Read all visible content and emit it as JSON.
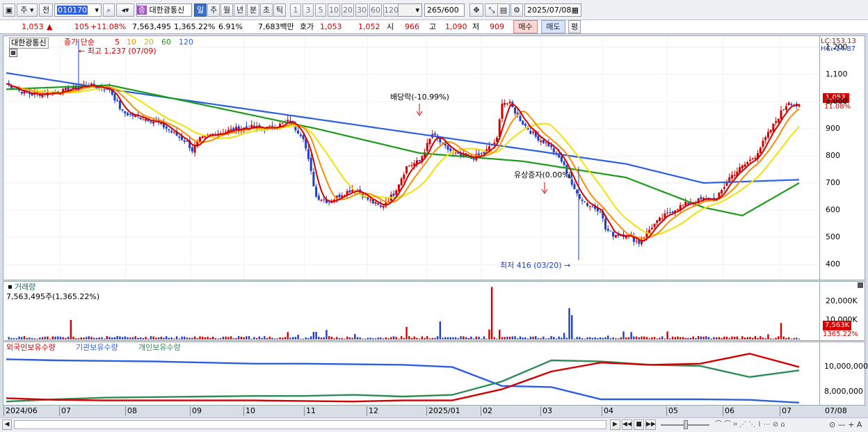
{
  "toolbar": {
    "period_label": "주",
    "prev_label": "전",
    "code": "010170",
    "stock_name": "대한광통신",
    "badge": "증",
    "periods": [
      "일",
      "주",
      "월",
      "년",
      "분",
      "초",
      "틱"
    ],
    "active_period": "일",
    "numbers": [
      "1",
      "3",
      "5",
      "10",
      "20",
      "30",
      "60",
      "120"
    ],
    "count": "265",
    "count_total": "/600",
    "date": "2025/07/08"
  },
  "quote": {
    "price": "1,053",
    "change": "105",
    "change_pct": "+11.08%",
    "volume": "7,563,495",
    "vol_ratio": "1,365.22%",
    "turnover": "6.91%",
    "amount": "7,683백만",
    "ask_label": "호가",
    "ask": "1,053",
    "bid": "1,052",
    "open_label": "시",
    "open": "966",
    "high_label": "고",
    "high": "1,090",
    "low_label": "저",
    "low": "909",
    "buy": "매수",
    "sell": "매도",
    "eval": "평"
  },
  "price_panel": {
    "name": "대한광통신",
    "legend_prefix": "종가 단순",
    "ma": [
      "5",
      "10",
      "20",
      "60",
      "120"
    ],
    "ma_colors": [
      "#d40000",
      "#ff8c00",
      "#f2e200",
      "#1a9b1a",
      "#2d5fe0"
    ],
    "high_note": "최고 1,237 (07/09)",
    "low_note": "최저 416 (03/20)",
    "div_note": "배당락(-10.99%)",
    "rights_note": "유상증자(0.00%)",
    "lc": "LC:153.13",
    "hc": "HC:-14.87",
    "last_price": "1,053",
    "last_pct": "11.08%",
    "yticks": [
      "1,200",
      "1,100",
      "1,000",
      "900",
      "800",
      "700",
      "600",
      "500",
      "400"
    ]
  },
  "volume_panel": {
    "title": "거래량",
    "info": "7,563,495주(1,365.22%)",
    "yticks": [
      "20,000K",
      "10,000K"
    ],
    "last": "7,563K",
    "last_pct": "1365.22%"
  },
  "holdings_panel": {
    "legend": [
      "외국인보유수량",
      "기관보유수량",
      "개인보유수량"
    ],
    "colors": [
      "#d40000",
      "#2d5fe0",
      "#2e8b57"
    ],
    "yticks": [
      "10,000,000",
      "8,000,000"
    ]
  },
  "xaxis": [
    "2024/06",
    "07",
    "08",
    "09",
    "10",
    "11",
    "12",
    "2025/01",
    "02",
    "03",
    "04",
    "05",
    "06",
    "07"
  ],
  "xaxis_right": "07/08",
  "chart_data": {
    "type": "candlestick",
    "ylim": [
      380,
      1230
    ],
    "close_path": [
      [
        0,
        1065
      ],
      [
        5,
        1040
      ],
      [
        10,
        1025
      ],
      [
        15,
        1030
      ],
      [
        20,
        1035
      ],
      [
        25,
        1045
      ],
      [
        30,
        1060
      ],
      [
        35,
        1055
      ],
      [
        40,
        1045
      ],
      [
        45,
        960
      ],
      [
        50,
        945
      ],
      [
        55,
        935
      ],
      [
        60,
        915
      ],
      [
        65,
        880
      ],
      [
        70,
        850
      ],
      [
        72,
        820
      ],
      [
        75,
        860
      ],
      [
        80,
        880
      ],
      [
        85,
        890
      ],
      [
        90,
        900
      ],
      [
        95,
        905
      ],
      [
        100,
        900
      ],
      [
        105,
        910
      ],
      [
        110,
        930
      ],
      [
        112,
        900
      ],
      [
        115,
        870
      ],
      [
        120,
        650
      ],
      [
        125,
        630
      ],
      [
        130,
        660
      ],
      [
        135,
        680
      ],
      [
        140,
        640
      ],
      [
        145,
        610
      ],
      [
        150,
        660
      ],
      [
        155,
        760
      ],
      [
        160,
        780
      ],
      [
        165,
        880
      ],
      [
        170,
        830
      ],
      [
        175,
        800
      ],
      [
        180,
        790
      ],
      [
        185,
        810
      ],
      [
        190,
        860
      ],
      [
        192,
        1000
      ],
      [
        195,
        990
      ],
      [
        200,
        920
      ],
      [
        205,
        870
      ],
      [
        210,
        840
      ],
      [
        215,
        780
      ],
      [
        218,
        720
      ],
      [
        220,
        670
      ],
      [
        225,
        620
      ],
      [
        230,
        600
      ],
      [
        232,
        530
      ],
      [
        235,
        510
      ],
      [
        240,
        510
      ],
      [
        245,
        480
      ],
      [
        250,
        540
      ],
      [
        255,
        580
      ],
      [
        260,
        610
      ],
      [
        265,
        630
      ],
      [
        270,
        640
      ],
      [
        275,
        640
      ],
      [
        280,
        720
      ],
      [
        285,
        760
      ],
      [
        290,
        800
      ],
      [
        295,
        880
      ],
      [
        300,
        960
      ],
      [
        303,
        1000
      ],
      [
        307,
        980
      ]
    ],
    "ma_120": [
      [
        0,
        1105
      ],
      [
        40,
        1045
      ],
      [
        80,
        990
      ],
      [
        120,
        935
      ],
      [
        160,
        880
      ],
      [
        200,
        825
      ],
      [
        240,
        770
      ],
      [
        270,
        700
      ],
      [
        307,
        712
      ]
    ],
    "ma_60": [
      [
        0,
        1045
      ],
      [
        40,
        1060
      ],
      [
        80,
        980
      ],
      [
        120,
        900
      ],
      [
        160,
        810
      ],
      [
        200,
        780
      ],
      [
        240,
        720
      ],
      [
        270,
        610
      ],
      [
        285,
        580
      ],
      [
        307,
        700
      ]
    ],
    "holdings": {
      "institution": [
        10.9,
        10.8,
        10.75,
        10.7,
        10.6,
        10.5,
        10.5,
        10.45,
        10.4,
        10.2,
        8.5,
        8.4,
        7.3,
        7.3,
        7.3,
        7.25,
        7.0
      ],
      "individual": [
        7.1,
        7.3,
        7.45,
        7.5,
        7.55,
        7.6,
        7.6,
        7.7,
        7.55,
        7.7,
        8.9,
        10.8,
        10.7,
        10.4,
        10.3,
        9.3,
        9.9
      ],
      "foreign": [
        7.4,
        7.25,
        7.2,
        7.2,
        7.2,
        7.2,
        7.15,
        7.1,
        7.2,
        7.2,
        8.2,
        9.8,
        10.6,
        10.4,
        10.5,
        11.4,
        10.2
      ]
    }
  }
}
